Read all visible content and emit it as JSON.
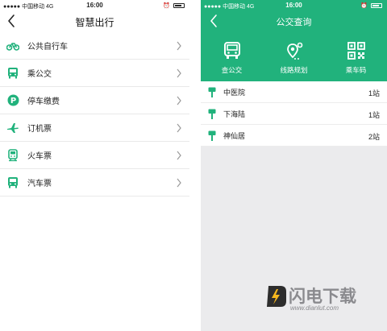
{
  "left": {
    "status": {
      "carrier": "●●●●● 中国移动  4G",
      "time": "16:00"
    },
    "title": "智慧出行",
    "menu": [
      {
        "label": "公共自行车",
        "icon": "bicycle-icon"
      },
      {
        "label": "乘公交",
        "icon": "bus-icon"
      },
      {
        "label": "停车缴费",
        "icon": "parking-icon"
      },
      {
        "label": "订机票",
        "icon": "airplane-icon"
      },
      {
        "label": "火车票",
        "icon": "train-icon"
      },
      {
        "label": "汽车票",
        "icon": "coach-icon"
      }
    ]
  },
  "right": {
    "status": {
      "carrier": "●●●●● 中国移动  4G",
      "time": "16:00"
    },
    "title": "公交查询",
    "tabs": [
      {
        "label": "查公交",
        "icon": "bus-icon"
      },
      {
        "label": "线路规划",
        "icon": "route-pin-icon"
      },
      {
        "label": "乘车码",
        "icon": "qr-code-icon"
      }
    ],
    "stops": [
      {
        "name": "中医院",
        "count": "1站"
      },
      {
        "name": "下海陆",
        "count": "1站"
      },
      {
        "name": "神仙居",
        "count": "2站"
      }
    ]
  },
  "watermark": {
    "brand": "闪电下载",
    "url": "www.dianlut.com"
  },
  "colors": {
    "accent": "#21b27c",
    "background": "#ebebed"
  }
}
